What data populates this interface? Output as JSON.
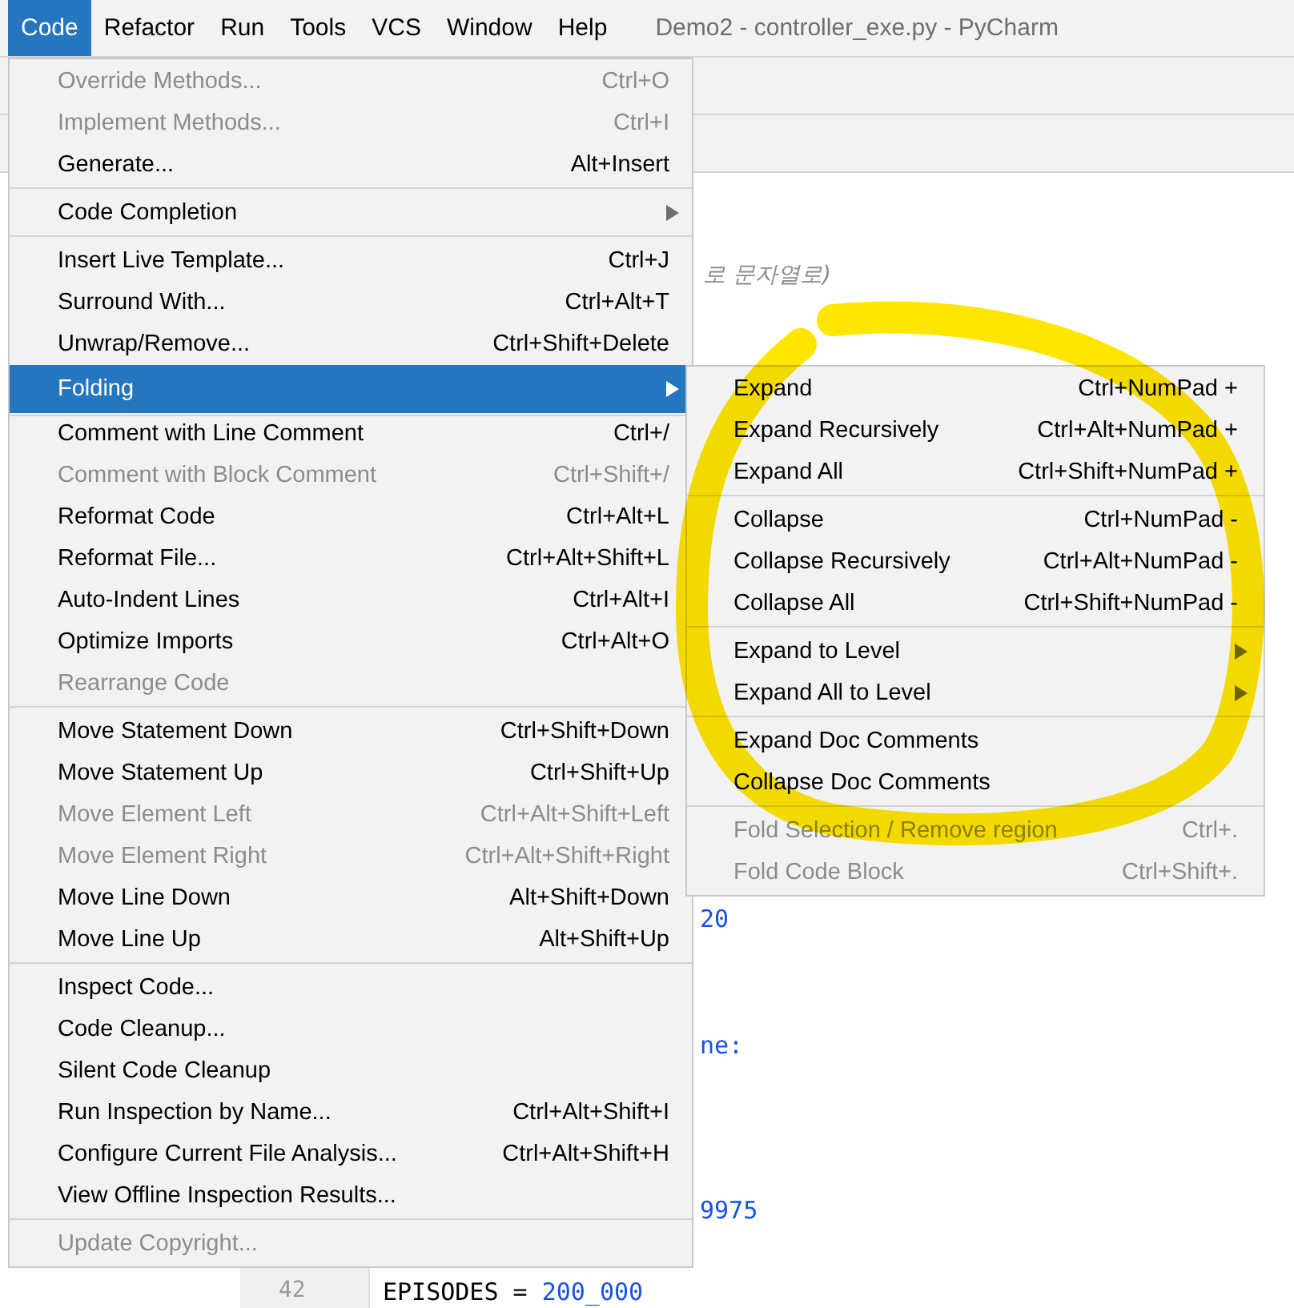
{
  "menu_bar": [
    {
      "label": "Code",
      "selected": true
    },
    {
      "label": "Refactor",
      "selected": false
    },
    {
      "label": "Run",
      "selected": false
    },
    {
      "label": "Tools",
      "selected": false
    },
    {
      "label": "VCS",
      "selected": false
    },
    {
      "label": "Window",
      "selected": false
    },
    {
      "label": "Help",
      "selected": false
    }
  ],
  "window": {
    "title": "Demo2 - controller_exe.py - PyCharm"
  },
  "editor": {
    "comment": "로 문자열로)",
    "lines": [
      {
        "text": "20"
      },
      {
        "text": "ne:"
      },
      {
        "text": "9975"
      }
    ],
    "last_line": {
      "number": "42",
      "code": "EPISODES = ",
      "value": "200_000"
    }
  },
  "code_menu": [
    {
      "kind": "item",
      "label": "Override Methods...",
      "shortcut": "Ctrl+O",
      "disabled": true,
      "submenu": false,
      "selected": false
    },
    {
      "kind": "item",
      "label": "Implement Methods...",
      "shortcut": "Ctrl+I",
      "disabled": true,
      "submenu": false,
      "selected": false
    },
    {
      "kind": "item",
      "label": "Generate...",
      "shortcut": "Alt+Insert",
      "disabled": false,
      "submenu": false,
      "selected": false
    },
    {
      "kind": "separator"
    },
    {
      "kind": "item",
      "label": "Code Completion",
      "disabled": false,
      "submenu": true,
      "selected": false
    },
    {
      "kind": "separator"
    },
    {
      "kind": "item",
      "label": "Insert Live Template...",
      "shortcut": "Ctrl+J",
      "disabled": false,
      "submenu": false,
      "selected": false
    },
    {
      "kind": "item",
      "label": "Surround With...",
      "shortcut": "Ctrl+Alt+T",
      "disabled": false,
      "submenu": false,
      "selected": false
    },
    {
      "kind": "item",
      "label": "Unwrap/Remove...",
      "shortcut": "Ctrl+Shift+Delete",
      "disabled": false,
      "submenu": false,
      "selected": false
    },
    {
      "kind": "separator"
    },
    {
      "kind": "item",
      "label": "Folding",
      "disabled": false,
      "submenu": true,
      "selected": true
    },
    {
      "kind": "separator"
    },
    {
      "kind": "item",
      "label": "Comment with Line Comment",
      "shortcut": "Ctrl+/",
      "disabled": false,
      "submenu": false,
      "selected": false
    },
    {
      "kind": "item",
      "label": "Comment with Block Comment",
      "shortcut": "Ctrl+Shift+/",
      "disabled": true,
      "submenu": false,
      "selected": false
    },
    {
      "kind": "item",
      "label": "Reformat Code",
      "shortcut": "Ctrl+Alt+L",
      "disabled": false,
      "submenu": false,
      "selected": false
    },
    {
      "kind": "item",
      "label": "Reformat File...",
      "shortcut": "Ctrl+Alt+Shift+L",
      "disabled": false,
      "submenu": false,
      "selected": false
    },
    {
      "kind": "item",
      "label": "Auto-Indent Lines",
      "shortcut": "Ctrl+Alt+I",
      "disabled": false,
      "submenu": false,
      "selected": false
    },
    {
      "kind": "item",
      "label": "Optimize Imports",
      "shortcut": "Ctrl+Alt+O",
      "disabled": false,
      "submenu": false,
      "selected": false
    },
    {
      "kind": "item",
      "label": "Rearrange Code",
      "disabled": true,
      "submenu": false,
      "selected": false
    },
    {
      "kind": "separator"
    },
    {
      "kind": "item",
      "label": "Move Statement Down",
      "shortcut": "Ctrl+Shift+Down",
      "disabled": false,
      "submenu": false,
      "selected": false
    },
    {
      "kind": "item",
      "label": "Move Statement Up",
      "shortcut": "Ctrl+Shift+Up",
      "disabled": false,
      "submenu": false,
      "selected": false
    },
    {
      "kind": "item",
      "label": "Move Element Left",
      "shortcut": "Ctrl+Alt+Shift+Left",
      "disabled": true,
      "submenu": false,
      "selected": false
    },
    {
      "kind": "item",
      "label": "Move Element Right",
      "shortcut": "Ctrl+Alt+Shift+Right",
      "disabled": true,
      "submenu": false,
      "selected": false
    },
    {
      "kind": "item",
      "label": "Move Line Down",
      "shortcut": "Alt+Shift+Down",
      "disabled": false,
      "submenu": false,
      "selected": false
    },
    {
      "kind": "item",
      "label": "Move Line Up",
      "shortcut": "Alt+Shift+Up",
      "disabled": false,
      "submenu": false,
      "selected": false
    },
    {
      "kind": "separator"
    },
    {
      "kind": "item",
      "label": "Inspect Code...",
      "disabled": false,
      "submenu": false,
      "selected": false
    },
    {
      "kind": "item",
      "label": "Code Cleanup...",
      "disabled": false,
      "submenu": false,
      "selected": false
    },
    {
      "kind": "item",
      "label": "Silent Code Cleanup",
      "disabled": false,
      "submenu": false,
      "selected": false
    },
    {
      "kind": "item",
      "label": "Run Inspection by Name...",
      "shortcut": "Ctrl+Alt+Shift+I",
      "disabled": false,
      "submenu": false,
      "selected": false
    },
    {
      "kind": "item",
      "label": "Configure Current File Analysis...",
      "shortcut": "Ctrl+Alt+Shift+H",
      "disabled": false,
      "submenu": false,
      "selected": false
    },
    {
      "kind": "item",
      "label": "View Offline Inspection Results...",
      "disabled": false,
      "submenu": false,
      "selected": false
    },
    {
      "kind": "separator"
    },
    {
      "kind": "item",
      "label": "Update Copyright...",
      "disabled": true,
      "submenu": false,
      "selected": false
    }
  ],
  "folding_menu": [
    {
      "kind": "item",
      "label": "Expand",
      "shortcut": "Ctrl+NumPad +",
      "disabled": false,
      "submenu": false,
      "selected": false
    },
    {
      "kind": "item",
      "label": "Expand Recursively",
      "shortcut": "Ctrl+Alt+NumPad +",
      "disabled": false,
      "submenu": false,
      "selected": false
    },
    {
      "kind": "item",
      "label": "Expand All",
      "shortcut": "Ctrl+Shift+NumPad +",
      "disabled": false,
      "submenu": false,
      "selected": false
    },
    {
      "kind": "separator"
    },
    {
      "kind": "item",
      "label": "Collapse",
      "shortcut": "Ctrl+NumPad -",
      "disabled": false,
      "submenu": false,
      "selected": false
    },
    {
      "kind": "item",
      "label": "Collapse Recursively",
      "shortcut": "Ctrl+Alt+NumPad -",
      "disabled": false,
      "submenu": false,
      "selected": false
    },
    {
      "kind": "item",
      "label": "Collapse All",
      "shortcut": "Ctrl+Shift+NumPad -",
      "disabled": false,
      "submenu": false,
      "selected": false
    },
    {
      "kind": "separator"
    },
    {
      "kind": "item",
      "label": "Expand to Level",
      "disabled": false,
      "submenu": true,
      "selected": false
    },
    {
      "kind": "item",
      "label": "Expand All to Level",
      "disabled": false,
      "submenu": true,
      "selected": false
    },
    {
      "kind": "separator"
    },
    {
      "kind": "item",
      "label": "Expand Doc Comments",
      "disabled": false,
      "submenu": false,
      "selected": false
    },
    {
      "kind": "item",
      "label": "Collapse Doc Comments",
      "disabled": false,
      "submenu": false,
      "selected": false
    },
    {
      "kind": "separator"
    },
    {
      "kind": "item",
      "label": "Fold Selection / Remove region",
      "shortcut": "Ctrl+.",
      "disabled": true,
      "submenu": false,
      "selected": false
    },
    {
      "kind": "item",
      "label": "Fold Code Block",
      "shortcut": "Ctrl+Shift+.",
      "disabled": true,
      "submenu": false,
      "selected": false
    }
  ]
}
